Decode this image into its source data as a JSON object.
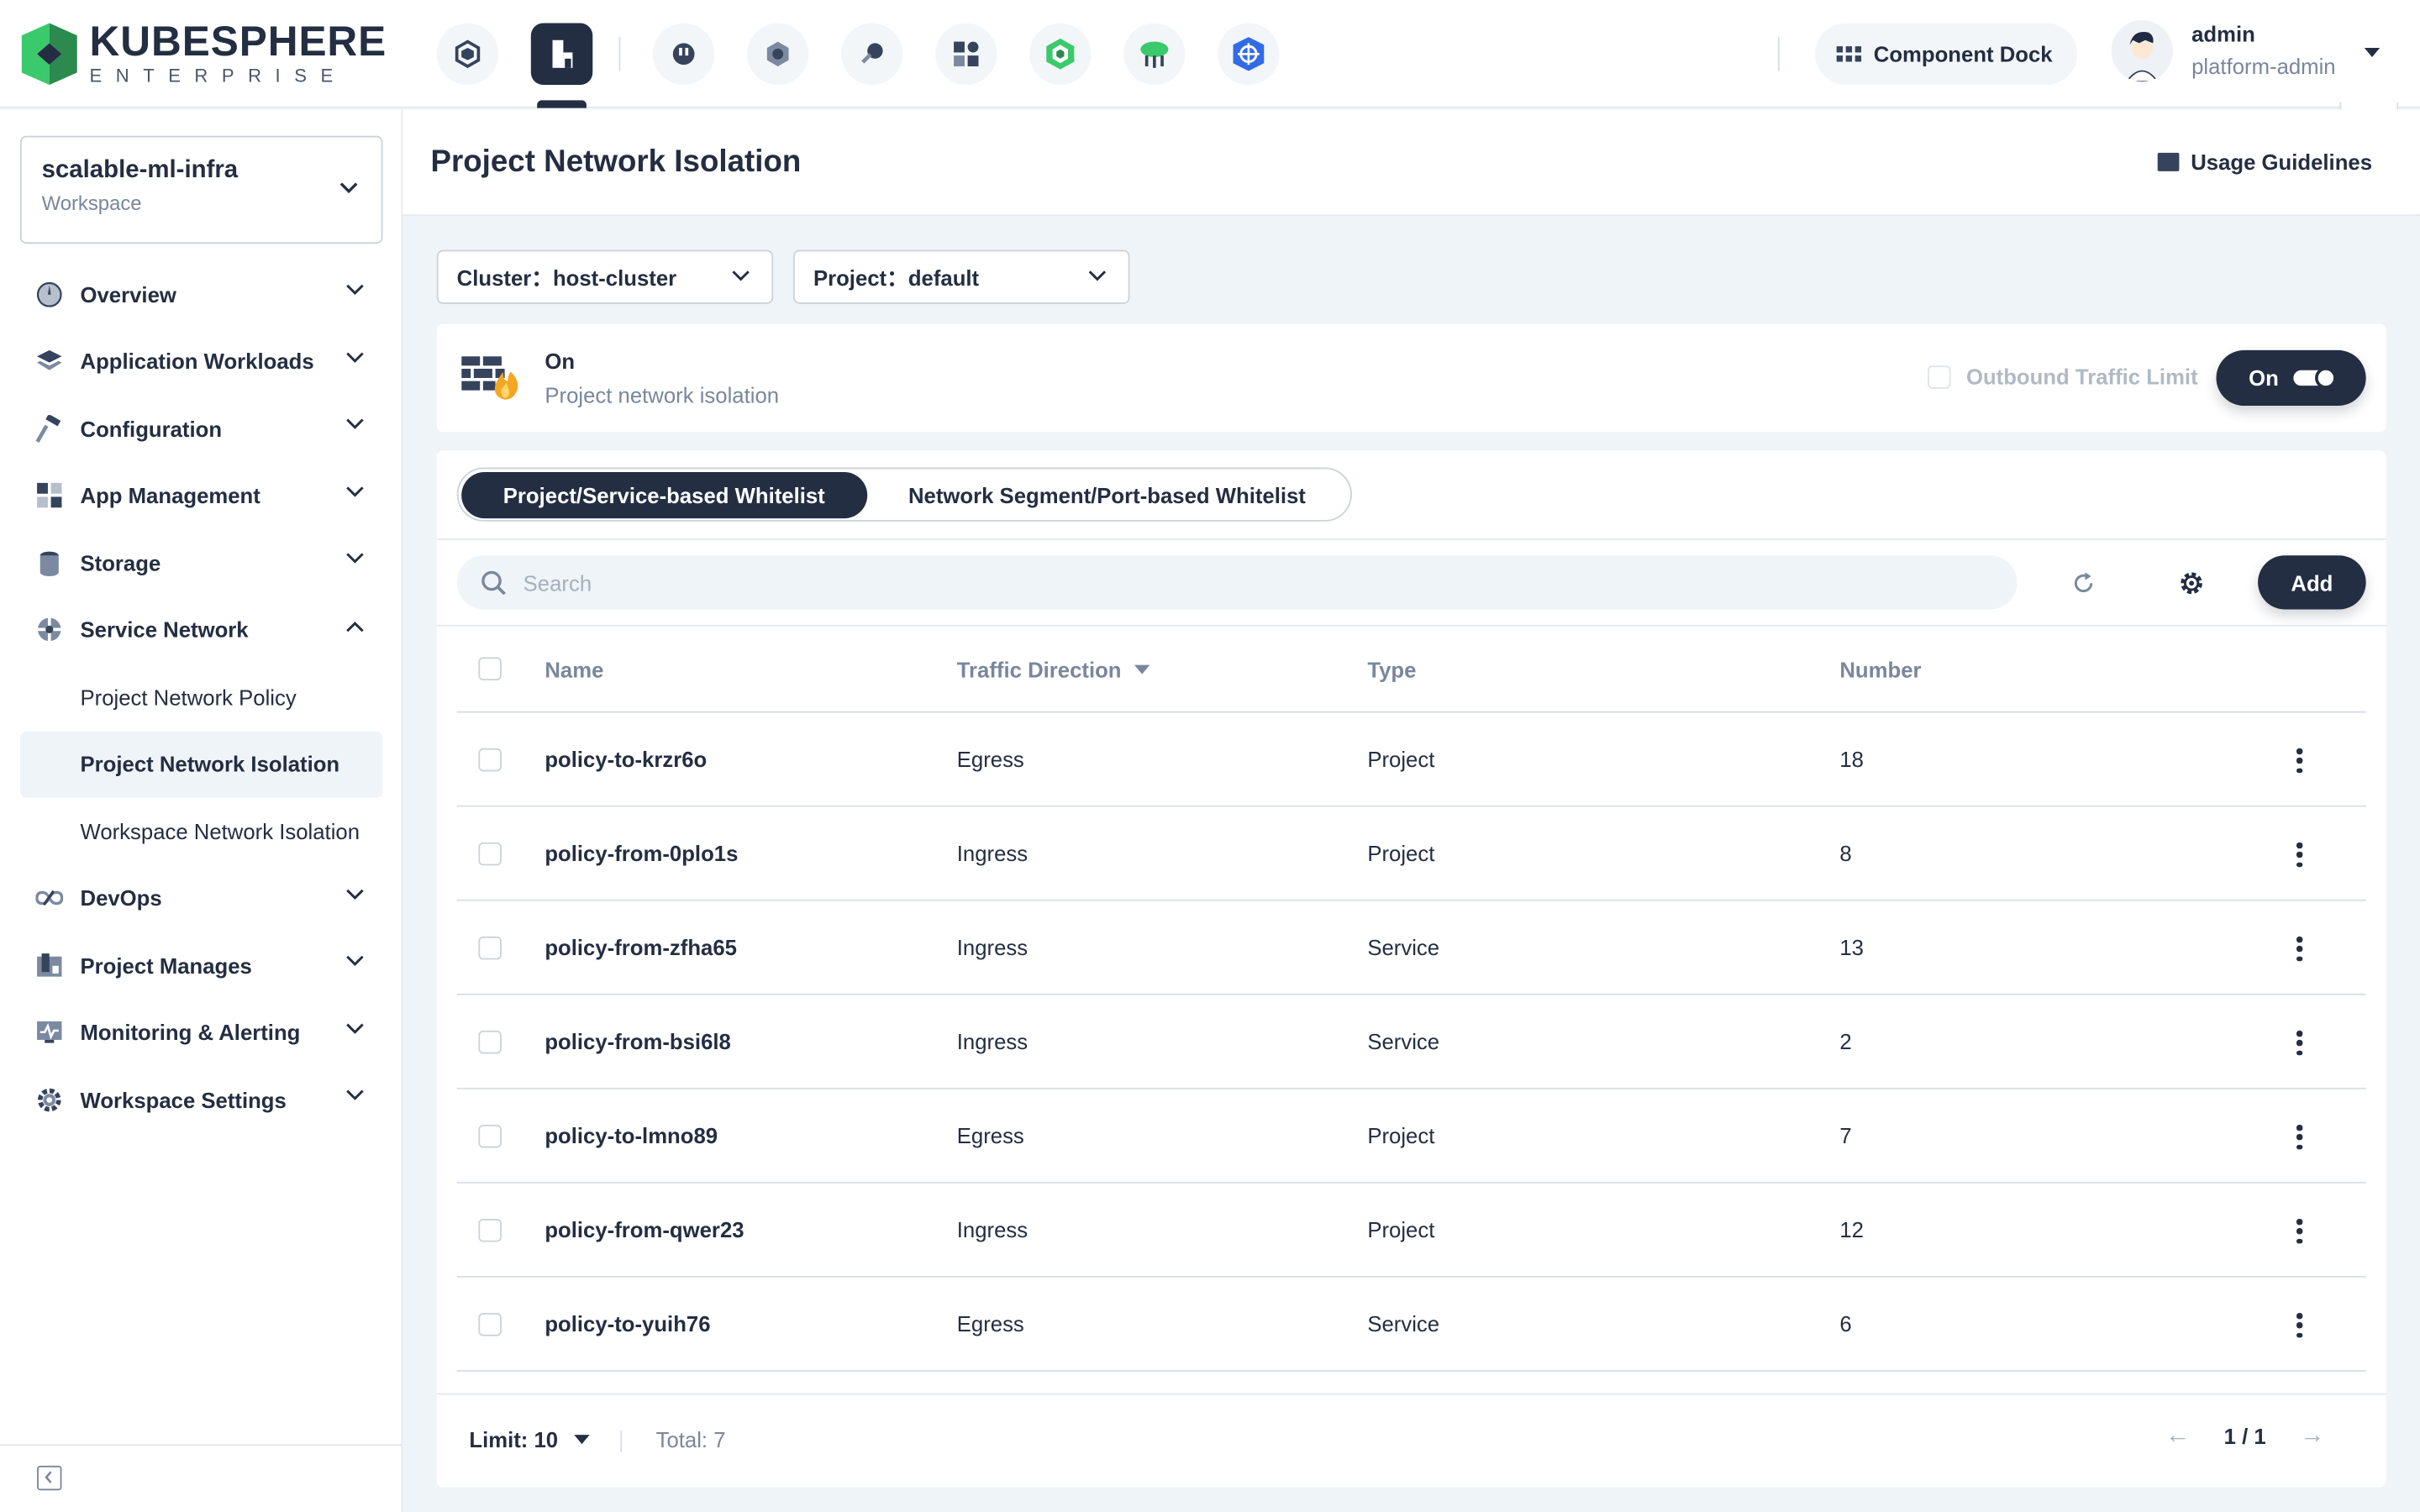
{
  "brand": {
    "title": "KUBESPHERE",
    "subtitle": "ENTERPRISE",
    "color": "#3ac96b"
  },
  "topnav": {
    "icons": [
      "cube-icon",
      "building-icon",
      "plug-icon",
      "hexagon-icon",
      "key-icon",
      "apps-icon",
      "package-icon",
      "cloud-icon",
      "helm-icon"
    ],
    "active_index": 1,
    "dock_label": "Component Dock"
  },
  "user": {
    "name": "admin",
    "role": "platform-admin"
  },
  "sidebar": {
    "workspace_name": "scalable-ml-infra",
    "workspace_label": "Workspace",
    "items": [
      {
        "label": "Overview",
        "icon": "gauge-icon"
      },
      {
        "label": "Application Workloads",
        "icon": "layers-icon"
      },
      {
        "label": "Configuration",
        "icon": "hammer-icon"
      },
      {
        "label": "App Management",
        "icon": "apps-icon"
      },
      {
        "label": "Storage",
        "icon": "database-icon"
      },
      {
        "label": "Service Network",
        "icon": "network-icon",
        "expanded": true,
        "children": [
          "Project Network Policy",
          "Project Network Isolation",
          "Workspace Network Isolation"
        ]
      },
      {
        "label": "DevOps",
        "icon": "infinity-icon"
      },
      {
        "label": "Project Manages",
        "icon": "project-icon"
      },
      {
        "label": "Monitoring & Alerting",
        "icon": "monitor-icon"
      },
      {
        "label": "Workspace Settings",
        "icon": "gear-icon"
      }
    ]
  },
  "header": {
    "title": "Project Network Isolation",
    "guide": "Usage Guidelines"
  },
  "filters": {
    "cluster": "Cluster：host-cluster",
    "project": "Project：default"
  },
  "isolation": {
    "status": "On",
    "description": "Project network isolation",
    "outbound_label": "Outbound Traffic Limit",
    "toggle_label": "On"
  },
  "tabs": [
    "Project/Service-based Whitelist",
    "Network Segment/Port-based Whitelist"
  ],
  "search": {
    "placeholder": "Search"
  },
  "add_label": "Add",
  "table": {
    "columns": [
      "Name",
      "Traffic Direction",
      "Type",
      "Number"
    ],
    "rows": [
      {
        "name": "policy-to-krzr6o",
        "direction": "Egress",
        "type": "Project",
        "number": "18"
      },
      {
        "name": "policy-from-0plo1s",
        "direction": "Ingress",
        "type": "Project",
        "number": "8"
      },
      {
        "name": "policy-from-zfha65",
        "direction": "Ingress",
        "type": "Service",
        "number": "13"
      },
      {
        "name": "policy-from-bsi6l8",
        "direction": "Ingress",
        "type": "Service",
        "number": "2"
      },
      {
        "name": "policy-to-lmno89",
        "direction": "Egress",
        "type": "Project",
        "number": "7"
      },
      {
        "name": "policy-from-qwer23",
        "direction": "Ingress",
        "type": "Project",
        "number": "12"
      },
      {
        "name": "policy-to-yuih76",
        "direction": "Egress",
        "type": "Service",
        "number": "6"
      }
    ]
  },
  "footer": {
    "limit": "Limit: 10",
    "total": "Total: 7",
    "page": "1 / 1"
  }
}
